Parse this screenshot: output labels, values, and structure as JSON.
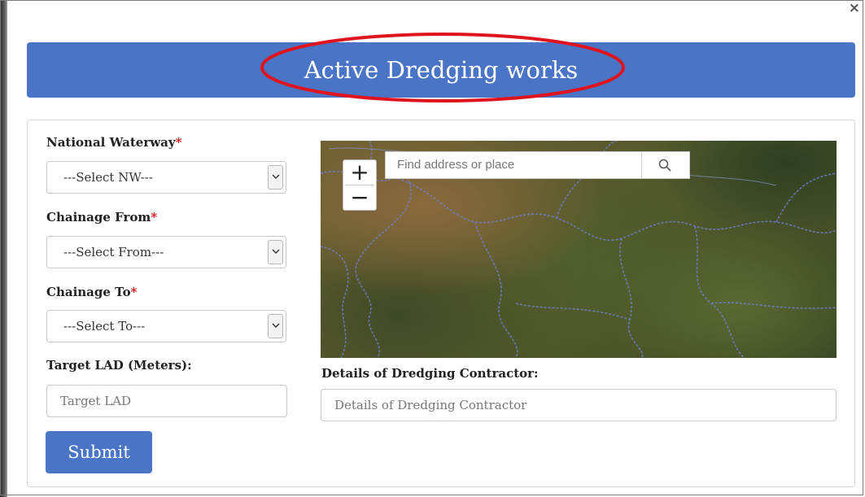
{
  "dialog": {
    "close_glyph": "×",
    "title": "Active Dredging works"
  },
  "form": {
    "national_waterway": {
      "label": "National Waterway",
      "required_mark": "*",
      "selected": "---Select NW---"
    },
    "chainage_from": {
      "label": "Chainage From",
      "required_mark": "*",
      "selected": "---Select From---"
    },
    "chainage_to": {
      "label": "Chainage To",
      "required_mark": "*",
      "selected": "---Select To---"
    },
    "target_lad": {
      "label": "Target LAD (Meters):",
      "placeholder": "Target LAD"
    },
    "contractor": {
      "label": "Details of Dredging Contractor:",
      "placeholder": "Details of Dredging Contractor"
    },
    "submit_label": "Submit"
  },
  "map": {
    "zoom_in": "+",
    "zoom_out": "−",
    "search_placeholder": "Find address or place",
    "search_icon": "search-icon"
  },
  "colors": {
    "header_bg": "#4a75c7",
    "highlight": "#e0141e",
    "required": "#d11111"
  }
}
